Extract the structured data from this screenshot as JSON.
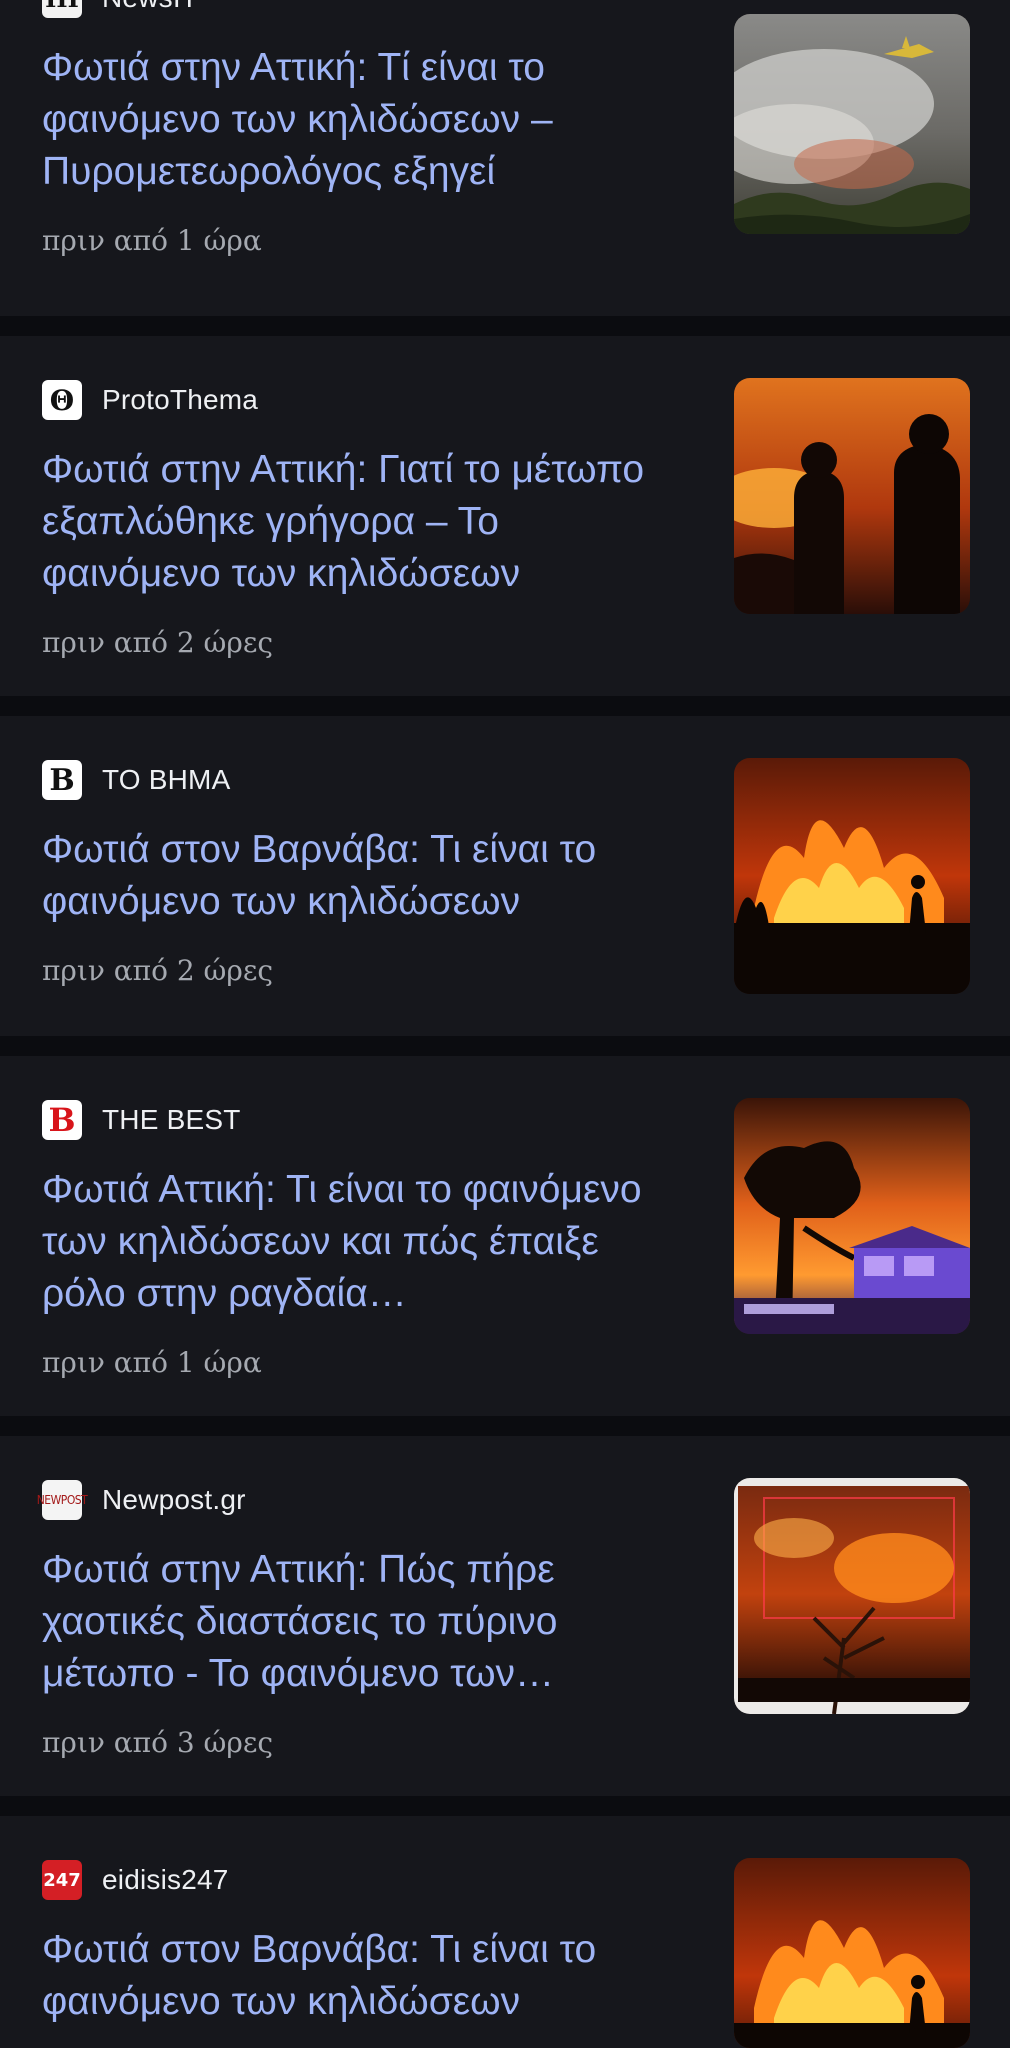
{
  "feed": {
    "items": [
      {
        "source": "NewsIT",
        "logo_icon": "newsit-logo-icon",
        "logo_glyph": "III",
        "headline": "Φωτιά στην Αττική: Τί είναι το φαινόμενο των κηλιδώσεων – Πυρομετεωρολόγος εξηγεί",
        "time": "πριν από 1 ώρα",
        "thumb": "firefighting-plane-smoke-image"
      },
      {
        "source": "ProtoThema",
        "logo_icon": "protothema-logo-icon",
        "logo_glyph": "Θ",
        "headline": "Φωτιά στην Αττική: Γιατί το μέτωπο εξαπλώθηκε γρήγορα – Το φαινόμενο των κηλιδώσεων",
        "time": "πριν από 2 ώρες",
        "thumb": "firefighters-silhouette-image"
      },
      {
        "source": "ΤΟ ΒΗΜΑ",
        "logo_icon": "tovima-logo-icon",
        "logo_glyph": "B",
        "headline": "Φωτιά στον Βαρνάβα: Τι είναι το φαινόμενο των κηλιδώσεων",
        "time": "πριν από 2 ώρες",
        "thumb": "wildfire-flames-image"
      },
      {
        "source": "THE BEST",
        "logo_icon": "thebest-logo-icon",
        "logo_glyph": "B",
        "headline": "Φωτιά Αττική: Τι είναι το φαινόμενο των κηλιδώσεων και πώς έπαιξε ρόλο στην ραγδαία…",
        "time": "πριν από 1 ώρα",
        "thumb": "burning-tree-house-image"
      },
      {
        "source": "Newpost.gr",
        "logo_icon": "newpost-logo-icon",
        "logo_glyph": "NEWPOST",
        "headline": "Φωτιά στην Αττική: Πώς πήρε χαοτικές διαστάσεις το πύρινο μέτωπο - Το φαινόμενο των…",
        "time": "πριν από 3 ώρες",
        "thumb": "forest-fire-night-image"
      },
      {
        "source": "eidisis247",
        "logo_icon": "eidisis247-logo-icon",
        "logo_glyph": "247",
        "headline": "Φωτιά στον Βαρνάβα: Τι είναι το φαινόμενο των κηλιδώσεων",
        "time": "",
        "thumb": "wildfire-flames-image"
      }
    ]
  },
  "colors": {
    "background": "#0b0c10",
    "card": "#16171c",
    "headline": "#9fb4f5",
    "source": "#eef0f3",
    "time": "#a5a9b0"
  }
}
